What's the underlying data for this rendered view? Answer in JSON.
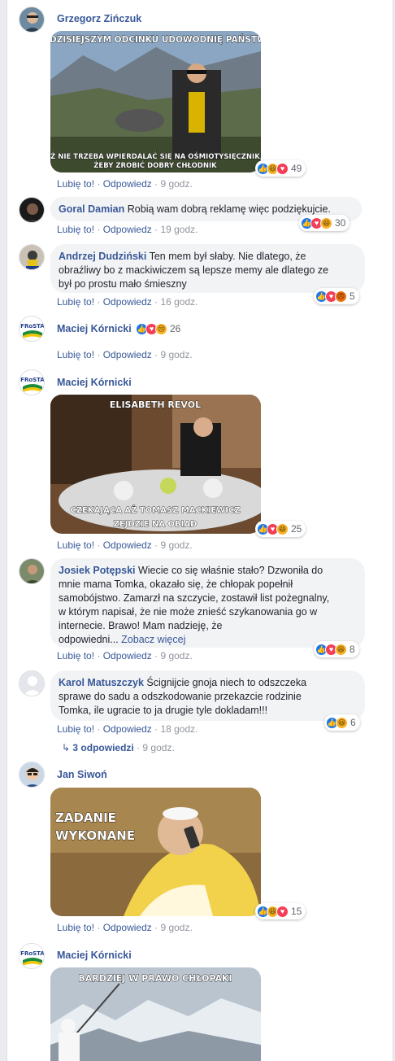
{
  "actions": {
    "like": "Lubię to!",
    "reply": "Odpowiedz",
    "sep": " · "
  },
  "comments": [
    {
      "author": "Grzegorz Zińczuk",
      "text": "",
      "meme_top": "W DZISIEJSZYM ODCINKU UDOWODNIĘ PAŃSTWU",
      "meme_bottom_1": "IŻ NIE TRZEBA WPIERDALAĆ SIĘ NA OŚMIOTYSIĘCZNIK,",
      "meme_bottom_2": "ŻEBY ZROBIĆ DOBRY CHŁODNIK",
      "time": "9 godz.",
      "reaction_count": "49",
      "reaction_icons": [
        "like-icon",
        "haha-icon",
        "love-icon"
      ]
    },
    {
      "author": "Goral Damian",
      "text": "Robią wam dobrą reklamę więc podziękujcie.",
      "time": "19 godz.",
      "reaction_count": "30",
      "reaction_icons": [
        "like-icon",
        "love-icon",
        "haha-icon"
      ]
    },
    {
      "author": "Andrzej Dudziński",
      "text_line1": "Ten mem był słaby. Nie dlatego, że",
      "text_line2": "obraźliwy bo z mackiwiczem są lepsze memy ale dlatego ze",
      "text_line3": "był po prostu mało śmieszny",
      "time": "16 godz.",
      "reaction_count": "5",
      "reaction_icons": [
        "like-icon",
        "love-icon",
        "angry-icon"
      ]
    },
    {
      "author": "Maciej Kórnicki",
      "time": "9 godz.",
      "reaction_count": "26",
      "reaction_icons": [
        "like-icon",
        "love-icon",
        "sad-icon"
      ]
    },
    {
      "author": "Maciej Kórnicki",
      "meme_top": "ELISABETH REVOL",
      "meme_bottom_1": "CZEKAJĄCA AŻ TOMASZ MACKIEWICZ",
      "meme_bottom_2": "ZEJDZIE NA OBIAD",
      "time": "9 godz.",
      "reaction_count": "25",
      "reaction_icons": [
        "like-icon",
        "love-icon",
        "haha-icon"
      ]
    },
    {
      "author": "Josiek Potępski",
      "text_line1": "Wiecie co się właśnie stało? Dzwoniła do",
      "text_line2": "mnie mama Tomka, okazało się, że chłopak popełnił",
      "text_line3": "samobójstwo. Zamarzł na szczycie, zostawił list pożegnalny,",
      "text_line4": "w którym napisał, że nie może znieść szykanowania go w",
      "text_line5": "internecie. Brawo! Mam nadzieję, że",
      "text_line6": "odpowiedni...",
      "see_more": "Zobacz więcej",
      "time": "9 godz.",
      "reaction_count": "8",
      "reaction_icons": [
        "like-icon",
        "love-icon",
        "haha-icon"
      ]
    },
    {
      "author": "Karol Matuszczyk",
      "text_line1": "Ścignijcie gnoja niech to odszczeka",
      "text_line2": "sprawe do sadu a odszkodowanie przekazcie rodzinie",
      "text_line3": "Tomka, ile ugracie to ja drugie tyle dokladam!!!",
      "time": "18 godz.",
      "reaction_count": "6",
      "reaction_icons": [
        "like-icon",
        "haha-icon"
      ],
      "replies_label": "3 odpowiedzi",
      "replies_time": "9 godz."
    },
    {
      "author": "Jan Siwoń",
      "meme_line1": "ZADANIE",
      "meme_line2": "WYKONANE",
      "time": "9 godz.",
      "reaction_count": "15",
      "reaction_icons": [
        "like-icon",
        "haha-icon",
        "love-icon"
      ]
    },
    {
      "author": "Maciej Kórnicki",
      "meme_top": "BARDZIEJ W PRAWO CHŁOPAKI"
    }
  ],
  "colors": {
    "link": "#385898",
    "meta": "#90949c",
    "bubble": "#f2f3f5",
    "like": "#1877f2",
    "love": "#f33e58",
    "haha": "#f7b125"
  }
}
